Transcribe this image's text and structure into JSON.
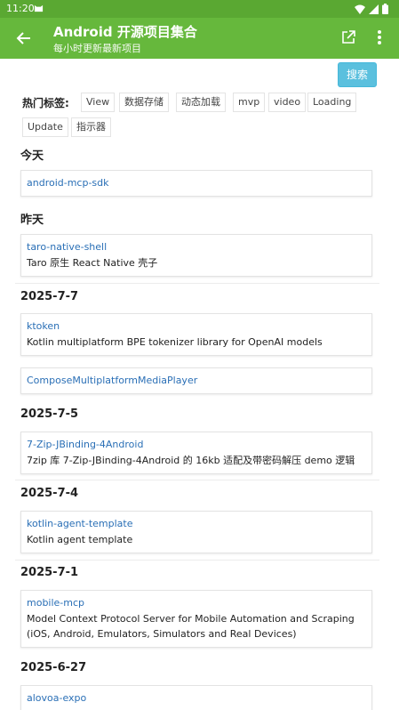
{
  "status_bar": {
    "time": "11:20"
  },
  "appbar": {
    "title": "Android 开源项目集合",
    "subtitle": "每小时更新最新项目"
  },
  "search_button": "搜索",
  "tags": {
    "label": "热门标签:",
    "items": [
      "View",
      "数据存储",
      "动态加载",
      "mvp",
      "video",
      "Loading",
      "Update",
      "指示器"
    ]
  },
  "groups": [
    {
      "date": "今天",
      "items": [
        {
          "name": "android-mcp-sdk",
          "desc": ""
        }
      ]
    },
    {
      "date": "昨天",
      "items": [
        {
          "name": "taro-native-shell",
          "desc": "Taro 原生 React Native 壳子"
        }
      ]
    },
    {
      "date": "2025-7-7",
      "items": [
        {
          "name": "ktoken",
          "desc": "Kotlin multiplatform BPE tokenizer library for OpenAI models"
        },
        {
          "name": "ComposeMultiplatformMediaPlayer",
          "desc": ""
        }
      ]
    },
    {
      "date": "2025-7-5",
      "items": [
        {
          "name": "7-Zip-JBinding-4Android",
          "desc": "7zip 库 7-Zip-JBinding-4Android 的 16kb 适配及带密码解压 demo 逻辑"
        }
      ]
    },
    {
      "date": "2025-7-4",
      "items": [
        {
          "name": "kotlin-agent-template",
          "desc": "Kotlin agent template"
        }
      ]
    },
    {
      "date": "2025-7-1",
      "items": [
        {
          "name": "mobile-mcp",
          "desc": "Model Context Protocol Server for Mobile Automation and Scraping (iOS, Android, Emulators, Simulators and Real Devices)"
        }
      ]
    },
    {
      "date": "2025-6-27",
      "items": [
        {
          "name": "alovoa-expo",
          "desc": ""
        }
      ]
    }
  ]
}
